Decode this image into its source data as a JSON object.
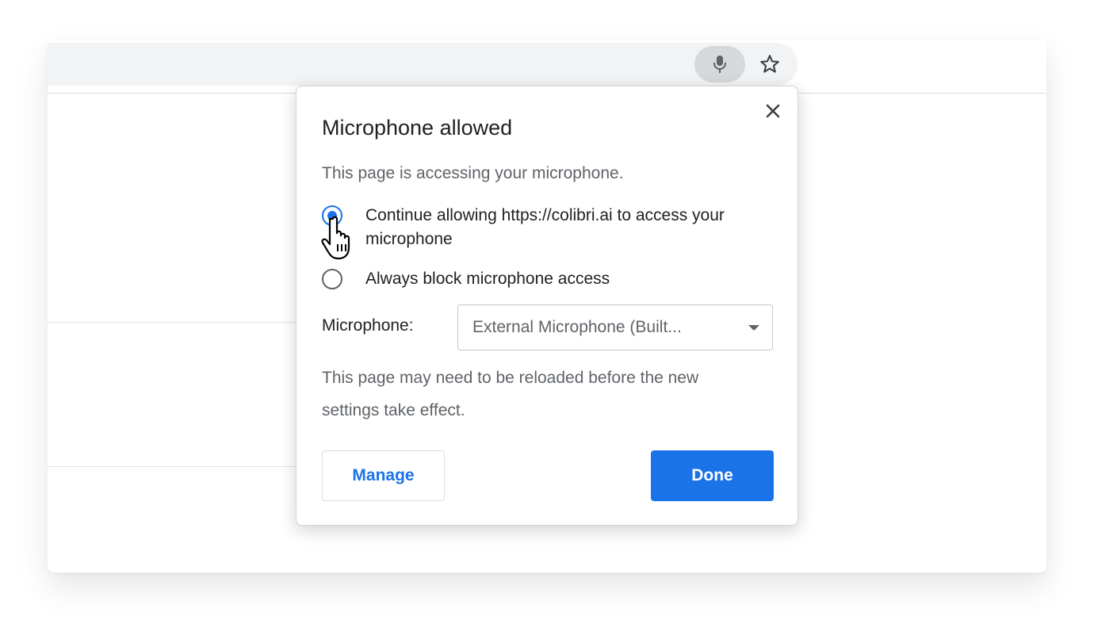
{
  "browser": {
    "mic_icon": "microphone-icon",
    "star_icon": "star-outline-icon"
  },
  "dialog": {
    "title": "Microphone allowed",
    "subtitle": "This page is accessing your microphone.",
    "close_icon": "close-icon",
    "options": [
      {
        "label": "Continue allowing https://colibri.ai to access your microphone",
        "checked": true
      },
      {
        "label": "Always block microphone access",
        "checked": false
      }
    ],
    "microphone_label": "Microphone:",
    "microphone_select_value": "External Microphone (Built...",
    "note": "This page may need to be reloaded before the new settings take effect.",
    "manage_label": "Manage",
    "done_label": "Done"
  },
  "colors": {
    "accent": "#1a73e8",
    "omnibox_bg": "#f1f3f4",
    "mic_chip_bg": "#d6d8da"
  }
}
